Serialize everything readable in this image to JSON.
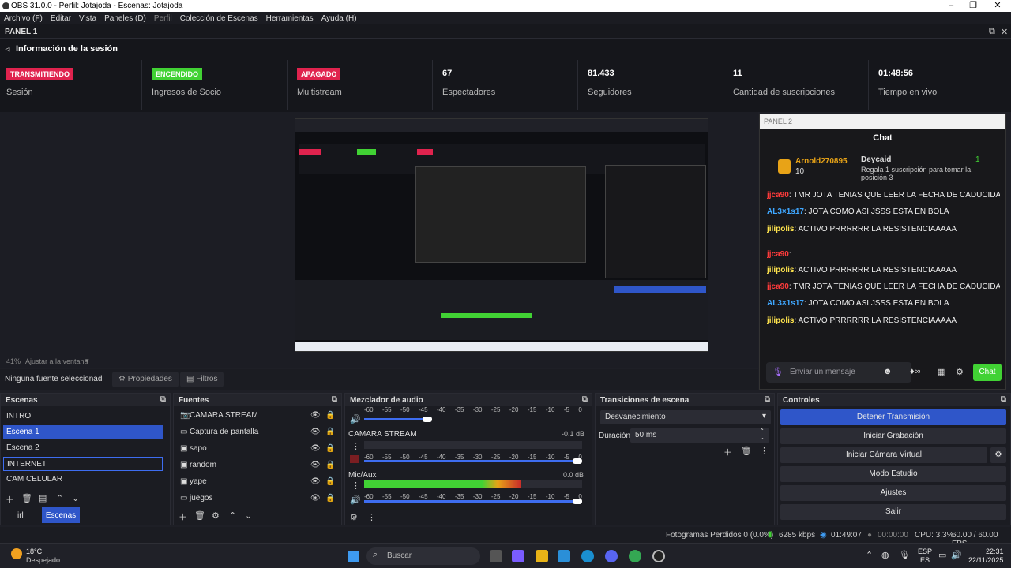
{
  "window": {
    "title": "OBS 31.0.0 - Perfil: Jotajoda - Escenas: Jotajoda"
  },
  "menu": [
    "Archivo (F)",
    "Editar",
    "Vista",
    "Paneles (D)",
    "Perfil",
    "Colección de Escenas",
    "Herramientas",
    "Ayuda (H)"
  ],
  "panel1": {
    "label": "PANEL 1"
  },
  "session": {
    "header": "Información de la sesión",
    "stats": [
      {
        "badge": "TRANSMITIENDO",
        "label": "Sesión",
        "badge_color": "#e0234e"
      },
      {
        "badge": "ENCENDIDO",
        "label": "Ingresos de Socio",
        "badge_color": "#41d234"
      },
      {
        "badge": "APAGADO",
        "label": "Multistream",
        "badge_color": "#e0234e"
      },
      {
        "value": "67",
        "label": "Espectadores"
      },
      {
        "value": "81.433",
        "label": "Seguidores"
      },
      {
        "value": "11",
        "label": "Cantidad de suscripciones"
      },
      {
        "value": "01:48:56",
        "label": "Tiempo en vivo"
      }
    ]
  },
  "preview": {
    "zoom": "41%",
    "fit": "Ajustar a la ventana"
  },
  "props": {
    "no_source": "Ninguna fuente seleccionad",
    "properties": "Propiedades",
    "filters": "Filtros"
  },
  "chat": {
    "panel": "PANEL 2",
    "title": "Chat",
    "leader": {
      "name": "Arnold270895",
      "count": "10"
    },
    "gift": {
      "name": "Deycaid",
      "text": "Regala 1 suscripción para tomar la posición 3",
      "count": "1"
    },
    "messages": [
      {
        "user": "jjca90",
        "text": "TMR JOTA TENIAS QUE LEER LA FECHA DE CADUCIDAD",
        "color": "#ff3b3b"
      },
      {
        "user": "AL3×1s17",
        "text": "JOTA COMO ASI JSSS ESTA EN BOLA",
        "color": "#3fa7ff"
      },
      {
        "user": "jilipolis",
        "text": "ACTIVO PRRRRRR LA RESISTENCIAAAAA",
        "color": "#ffe44d"
      },
      {
        "user": "jjca90",
        "text": "",
        "color": "#ff3b3b"
      },
      {
        "user": "jilipolis",
        "text": "ACTIVO PRRRRRR LA RESISTENCIAAAAA",
        "color": "#ffe44d"
      },
      {
        "user": "jjca90",
        "text": "TMR JOTA TENIAS QUE LEER LA FECHA DE CADUCIDAD",
        "color": "#ff3b3b"
      },
      {
        "user": "AL3×1s17",
        "text": "JOTA COMO ASI JSSS ESTA EN BOLA",
        "color": "#3fa7ff"
      },
      {
        "user": "jilipolis",
        "text": "ACTIVO PRRRRRR LA RESISTENCIAAAAA",
        "color": "#ffe44d"
      }
    ],
    "input_placeholder": "Enviar un mensaje",
    "send": "Chat"
  },
  "scenes": {
    "title": "Escenas",
    "items": [
      "INTRO",
      "Escena 1",
      "Escena 2",
      "INTERNET",
      "CAM CELULAR"
    ],
    "tabs": [
      "irl",
      "Escenas"
    ]
  },
  "sources": {
    "title": "Fuentes",
    "items": [
      "CAMARA STREAM",
      "Captura de pantalla",
      "sapo",
      "random",
      "yape",
      "juegos"
    ]
  },
  "mixer": {
    "title": "Mezclador de audio",
    "scale": [
      "-60",
      "-55",
      "-50",
      "-45",
      "-40",
      "-35",
      "-30",
      "-25",
      "-20",
      "-15",
      "-10",
      "-5",
      "0"
    ],
    "channels": [
      {
        "name": "CAMARA STREAM",
        "db": "-0.1 dB",
        "level": 0.0
      },
      {
        "name": "Mic/Aux",
        "db": "0.0 dB",
        "level": 0.72
      }
    ]
  },
  "transitions": {
    "title": "Transiciones de escena",
    "current": "Desvanecimiento",
    "duration_label": "Duración",
    "duration": "50 ms"
  },
  "controls": {
    "title": "Controles",
    "buttons": [
      "Detener Transmisión",
      "Iniciar Grabación",
      "Iniciar Cámara Virtual",
      "Modo Estudio",
      "Ajustes",
      "Salir"
    ]
  },
  "status": {
    "dropped": "Fotogramas Perdidos 0 (0.0%)",
    "bitrate": "6285 kbps",
    "live_time": "01:49:07",
    "rec_time": "00:00:00",
    "cpu": "CPU: 3.3%",
    "fps": "60.00 / 60.00 FPS"
  },
  "taskbar": {
    "weather_temp": "18°C",
    "weather_desc": "Despejado",
    "search": "Buscar",
    "lang1": "ESP",
    "lang2": "ES",
    "time": "22:31",
    "date": "22/11/2025"
  }
}
